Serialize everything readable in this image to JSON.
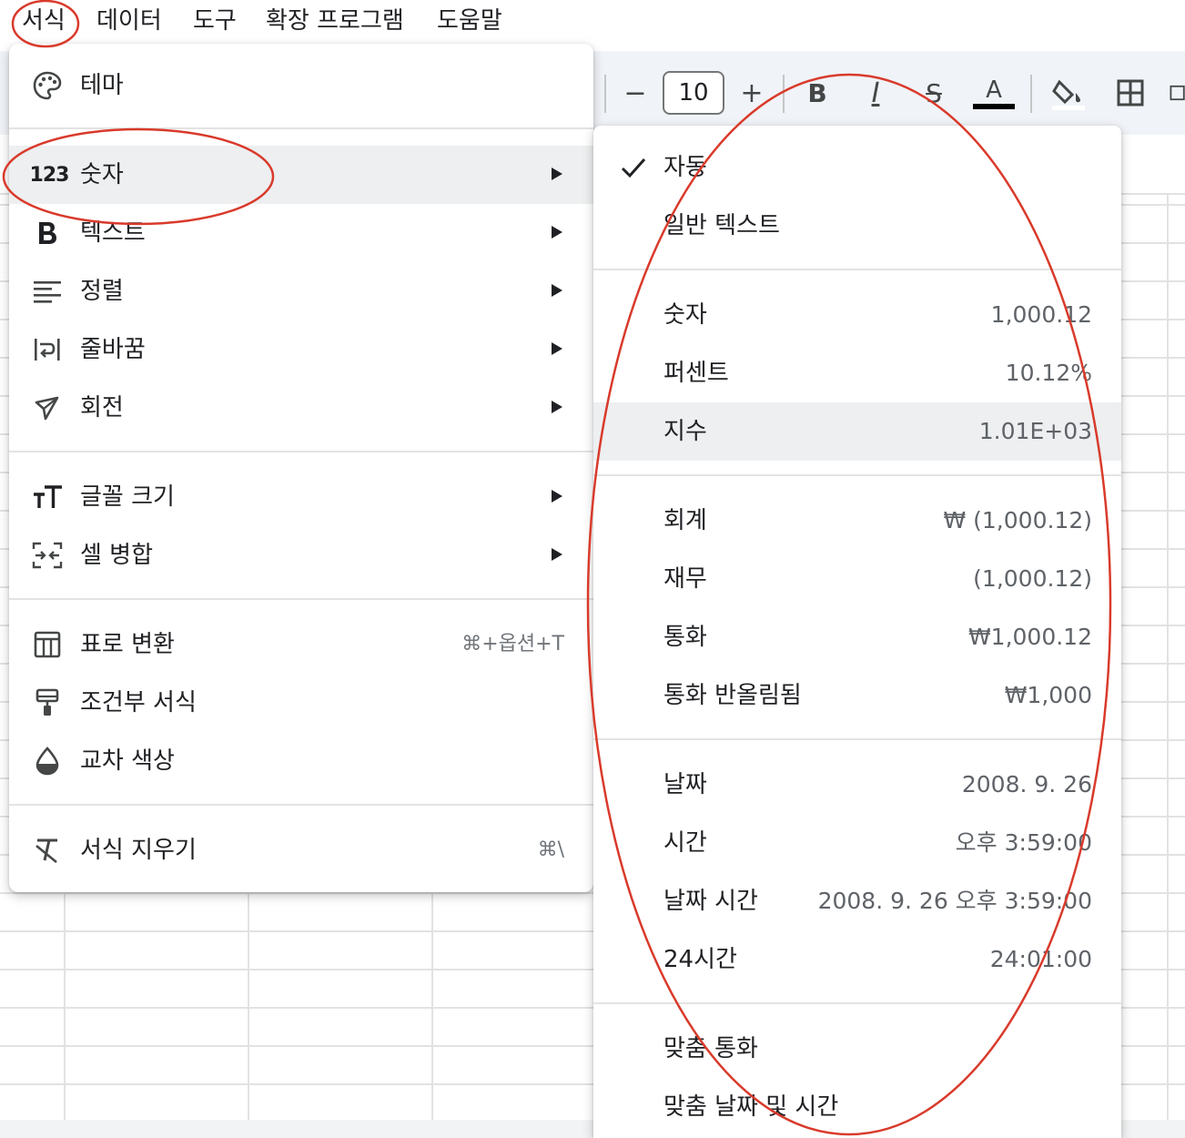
{
  "menubar": {
    "items": [
      "서식",
      "데이터",
      "도구",
      "확장 프로그램",
      "도움말"
    ]
  },
  "toolbar": {
    "minus": "−",
    "font_size": "10",
    "plus": "+",
    "bold": "B",
    "italic": "I",
    "strike": "S",
    "text_color": "A"
  },
  "format_menu": {
    "theme": "테마",
    "number": "숫자",
    "text": "텍스트",
    "align": "정렬",
    "wrap": "줄바꿈",
    "rotate": "회전",
    "font_size": "글꼴 크기",
    "merge": "셀 병합",
    "convert_table": "표로 변환",
    "convert_table_shortcut": "⌘+옵션+T",
    "conditional": "조건부 서식",
    "alternating": "교차 색상",
    "clear": "서식 지우기",
    "clear_shortcut": "⌘\\",
    "number_icon_text": "123"
  },
  "number_submenu": {
    "automatic": "자동",
    "plain_text": "일반 텍스트",
    "number": {
      "label": "숫자",
      "value": "1,000.12"
    },
    "percent": {
      "label": "퍼센트",
      "value": "10.12%"
    },
    "scientific": {
      "label": "지수",
      "value": "1.01E+03"
    },
    "accounting": {
      "label": "회계",
      "value": "₩ (1,000.12)"
    },
    "financial": {
      "label": "재무",
      "value": "(1,000.12)"
    },
    "currency": {
      "label": "통화",
      "value": "₩1,000.12"
    },
    "currency_rounded": {
      "label": "통화 반올림됨",
      "value": "₩1,000"
    },
    "date": {
      "label": "날짜",
      "value": "2008. 9. 26"
    },
    "time": {
      "label": "시간",
      "value": "오후 3:59:00"
    },
    "datetime": {
      "label": "날짜 시간",
      "value": "2008. 9. 26 오후 3:59:00"
    },
    "duration": {
      "label": "24시간",
      "value": "24:01:00"
    },
    "custom_currency": "맞춤 통화",
    "custom_datetime": "맞춤 날짜 및 시간"
  },
  "colors": {
    "annotation": "#d93a2b",
    "highlight": "#edeff0",
    "menu_text": "#202124",
    "secondary_text": "#5f6368"
  }
}
